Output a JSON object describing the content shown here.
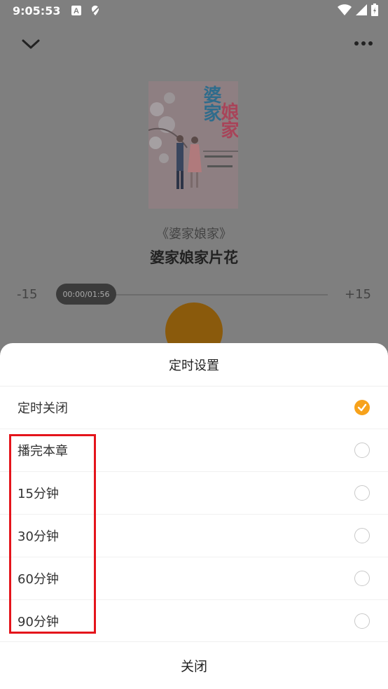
{
  "status_bar": {
    "time": "9:05:53",
    "icons": [
      "a-notification-icon",
      "no-location-icon",
      "wifi-icon",
      "signal-icon",
      "battery-icon"
    ]
  },
  "player": {
    "book_name": "《婆家娘家》",
    "chapter_name": "婆家娘家片花",
    "seek_back_label": "-15",
    "seek_forward_label": "+15",
    "time_progress": "00:00/01:56",
    "progress_fraction": 0,
    "cover_title_a": "婆家",
    "cover_title_b": "娘家"
  },
  "timer_sheet": {
    "title": "定时设置",
    "options": [
      {
        "label": "定时关闭",
        "selected": true
      },
      {
        "label": "播完本章",
        "selected": false
      },
      {
        "label": "15分钟",
        "selected": false
      },
      {
        "label": "30分钟",
        "selected": false
      },
      {
        "label": "60分钟",
        "selected": false
      },
      {
        "label": "90分钟",
        "selected": false
      }
    ],
    "close_label": "关闭"
  },
  "colors": {
    "accent": "#f7a21b",
    "highlight": "#e4141b",
    "overlay": "#7f7f7f"
  }
}
